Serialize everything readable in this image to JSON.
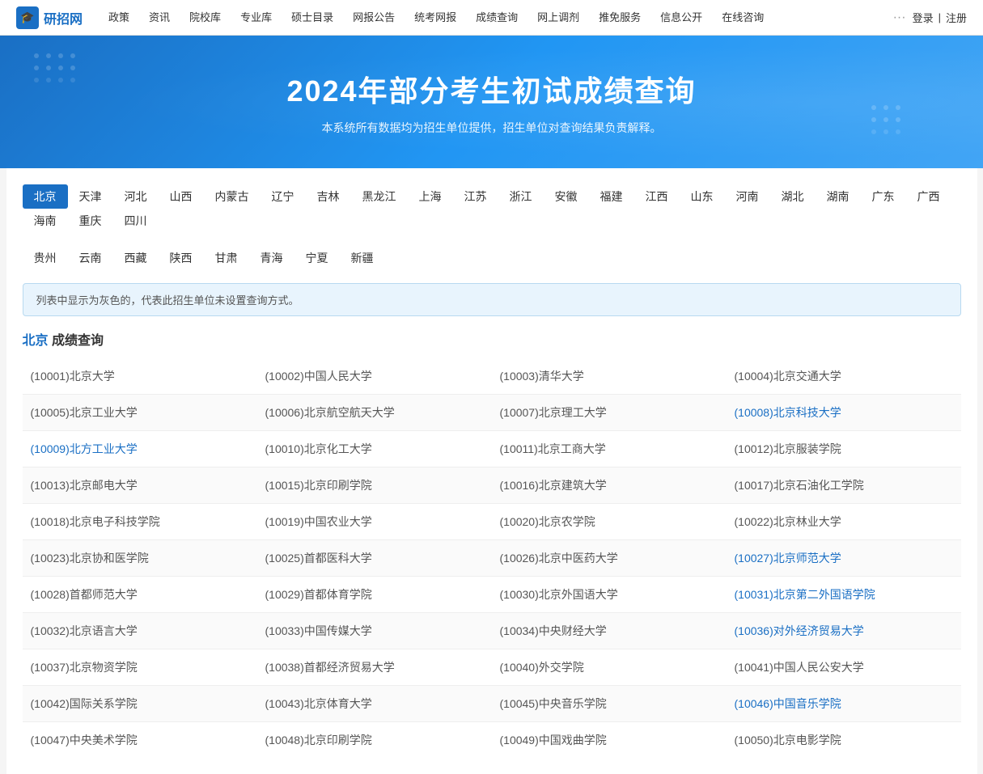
{
  "nav": {
    "logo_text": "研招网",
    "links": [
      {
        "label": "政策",
        "id": "zhengce"
      },
      {
        "label": "资讯",
        "id": "zixun"
      },
      {
        "label": "院校库",
        "id": "yuanxiaoku"
      },
      {
        "label": "专业库",
        "id": "zhuanyeku"
      },
      {
        "label": "硕士目录",
        "id": "shuoshimulu"
      },
      {
        "label": "网报公告",
        "id": "wangbaogonggao"
      },
      {
        "label": "统考网报",
        "id": "tongkaowangbao"
      },
      {
        "label": "成绩查询",
        "id": "chengjichaxun"
      },
      {
        "label": "网上调剂",
        "id": "wangshangdiaoji"
      },
      {
        "label": "推免服务",
        "id": "tuimianfuwu"
      },
      {
        "label": "信息公开",
        "id": "xinxigongkai"
      },
      {
        "label": "在线咨询",
        "id": "zaixunzixun"
      }
    ],
    "more": "···",
    "login": "登录",
    "divider": "|",
    "register": "注册"
  },
  "hero": {
    "title": "2024年部分考生初试成绩查询",
    "subtitle": "本系统所有数据均为招生单位提供，招生单位对查询结果负责解释。"
  },
  "regions": {
    "row1": [
      {
        "label": "北京",
        "id": "beijing",
        "active": true
      },
      {
        "label": "天津",
        "id": "tianjin"
      },
      {
        "label": "河北",
        "id": "hebei"
      },
      {
        "label": "山西",
        "id": "shanxi"
      },
      {
        "label": "内蒙古",
        "id": "neimenggu"
      },
      {
        "label": "辽宁",
        "id": "liaoning"
      },
      {
        "label": "吉林",
        "id": "jilin"
      },
      {
        "label": "黑龙江",
        "id": "heilongjiang"
      },
      {
        "label": "上海",
        "id": "shanghai"
      },
      {
        "label": "江苏",
        "id": "jiangsu"
      },
      {
        "label": "浙江",
        "id": "zhejiang"
      },
      {
        "label": "安徽",
        "id": "anhui"
      },
      {
        "label": "福建",
        "id": "fujian"
      },
      {
        "label": "江西",
        "id": "jiangxi"
      },
      {
        "label": "山东",
        "id": "shandong"
      },
      {
        "label": "河南",
        "id": "henan"
      },
      {
        "label": "湖北",
        "id": "hubei"
      },
      {
        "label": "湖南",
        "id": "hunan"
      },
      {
        "label": "广东",
        "id": "guangdong"
      },
      {
        "label": "广西",
        "id": "guangxi"
      },
      {
        "label": "海南",
        "id": "hainan"
      },
      {
        "label": "重庆",
        "id": "chongqing"
      },
      {
        "label": "四川",
        "id": "sichuan"
      }
    ],
    "row2": [
      {
        "label": "贵州",
        "id": "guizhou"
      },
      {
        "label": "云南",
        "id": "yunnan"
      },
      {
        "label": "西藏",
        "id": "xizang"
      },
      {
        "label": "陕西",
        "id": "shaanxi"
      },
      {
        "label": "甘肃",
        "id": "gansu"
      },
      {
        "label": "青海",
        "id": "qinghai"
      },
      {
        "label": "宁夏",
        "id": "ningxia"
      },
      {
        "label": "新疆",
        "id": "xinjiang"
      }
    ]
  },
  "info_box": "列表中显示为灰色的，代表此招生单位未设置查询方式。",
  "section": {
    "region": "北京",
    "suffix": "成绩查询"
  },
  "universities": [
    [
      {
        "code": "10001",
        "name": "北京大学",
        "link": false
      },
      {
        "code": "10002",
        "name": "中国人民大学",
        "link": false
      },
      {
        "code": "10003",
        "name": "清华大学",
        "link": false
      },
      {
        "code": "10004",
        "name": "北京交通大学",
        "link": false
      }
    ],
    [
      {
        "code": "10005",
        "name": "北京工业大学",
        "link": false
      },
      {
        "code": "10006",
        "name": "北京航空航天大学",
        "link": false
      },
      {
        "code": "10007",
        "name": "北京理工大学",
        "link": false
      },
      {
        "code": "10008",
        "name": "北京科技大学",
        "link": true
      }
    ],
    [
      {
        "code": "10009",
        "name": "北方工业大学",
        "link": true
      },
      {
        "code": "10010",
        "name": "北京化工大学",
        "link": false
      },
      {
        "code": "10011",
        "name": "北京工商大学",
        "link": false
      },
      {
        "code": "10012",
        "name": "北京服装学院",
        "link": false
      }
    ],
    [
      {
        "code": "10013",
        "name": "北京邮电大学",
        "link": false
      },
      {
        "code": "10015",
        "name": "北京印刷学院",
        "link": false
      },
      {
        "code": "10016",
        "name": "北京建筑大学",
        "link": false
      },
      {
        "code": "10017",
        "name": "北京石油化工学院",
        "link": false
      }
    ],
    [
      {
        "code": "10018",
        "name": "北京电子科技学院",
        "link": false
      },
      {
        "code": "10019",
        "name": "中国农业大学",
        "link": false
      },
      {
        "code": "10020",
        "name": "北京农学院",
        "link": false
      },
      {
        "code": "10022",
        "name": "北京林业大学",
        "link": false
      }
    ],
    [
      {
        "code": "10023",
        "name": "北京协和医学院",
        "link": false
      },
      {
        "code": "10025",
        "name": "首都医科大学",
        "link": false
      },
      {
        "code": "10026",
        "name": "北京中医药大学",
        "link": false
      },
      {
        "code": "10027",
        "name": "北京师范大学",
        "link": true
      }
    ],
    [
      {
        "code": "10028",
        "name": "首都师范大学",
        "link": false
      },
      {
        "code": "10029",
        "name": "首都体育学院",
        "link": false
      },
      {
        "code": "10030",
        "name": "北京外国语大学",
        "link": false
      },
      {
        "code": "10031",
        "name": "北京第二外国语学院",
        "link": true
      }
    ],
    [
      {
        "code": "10032",
        "name": "北京语言大学",
        "link": false
      },
      {
        "code": "10033",
        "name": "中国传媒大学",
        "link": false
      },
      {
        "code": "10034",
        "name": "中央财经大学",
        "link": false
      },
      {
        "code": "10036",
        "name": "对外经济贸易大学",
        "link": true
      }
    ],
    [
      {
        "code": "10037",
        "name": "北京物资学院",
        "link": false
      },
      {
        "code": "10038",
        "name": "首都经济贸易大学",
        "link": false
      },
      {
        "code": "10040",
        "name": "外交学院",
        "link": false
      },
      {
        "code": "10041",
        "name": "中国人民公安大学",
        "link": false
      }
    ],
    [
      {
        "code": "10042",
        "name": "国际关系学院",
        "link": false
      },
      {
        "code": "10043",
        "name": "北京体育大学",
        "link": false
      },
      {
        "code": "10045",
        "name": "中央音乐学院",
        "link": false
      },
      {
        "code": "10046",
        "name": "中国音乐学院",
        "link": true
      }
    ],
    [
      {
        "code": "10047",
        "name": "中央美术学院",
        "link": false
      },
      {
        "code": "10048",
        "name": "北京印刷学院",
        "link": false
      },
      {
        "code": "10049",
        "name": "中国戏曲学院",
        "link": false
      },
      {
        "code": "10050",
        "name": "北京电影学院",
        "link": false
      }
    ]
  ]
}
